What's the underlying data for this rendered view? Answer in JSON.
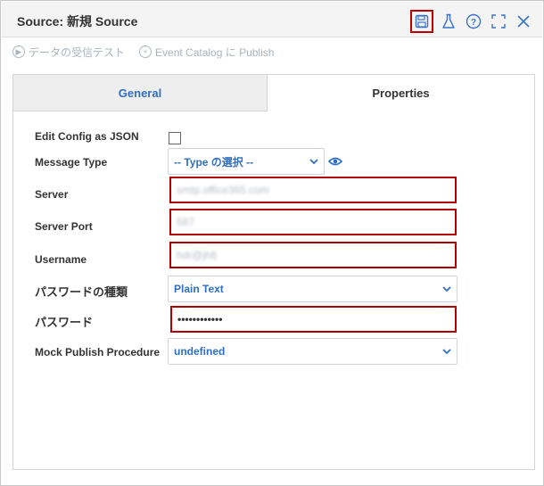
{
  "window": {
    "title": "Source: 新規 Source"
  },
  "toolbar": {
    "receive_test": "データの受信テスト",
    "publish": "Event Catalog に Publish"
  },
  "tabs": [
    {
      "label": "General",
      "active": false
    },
    {
      "label": "Properties",
      "active": true
    }
  ],
  "form": {
    "edit_config": {
      "label": "Edit Config as JSON",
      "checked": false
    },
    "message_type": {
      "label": "Message Type",
      "value": "-- Type の選択 --"
    },
    "server": {
      "label": "Server",
      "value": "smtp.office365.com"
    },
    "server_port": {
      "label": "Server Port",
      "value": "587"
    },
    "username": {
      "label": "Username",
      "value": "hdr@jhfj"
    },
    "password_type": {
      "label": "パスワードの種類",
      "value": "Plain Text"
    },
    "password": {
      "label": "パスワード",
      "value": "••••••••••••"
    },
    "mock_publish": {
      "label": "Mock Publish Procedure",
      "value": "undefined"
    }
  },
  "colors": {
    "accent": "#2f6fc3",
    "highlight_border": "#b00000"
  }
}
